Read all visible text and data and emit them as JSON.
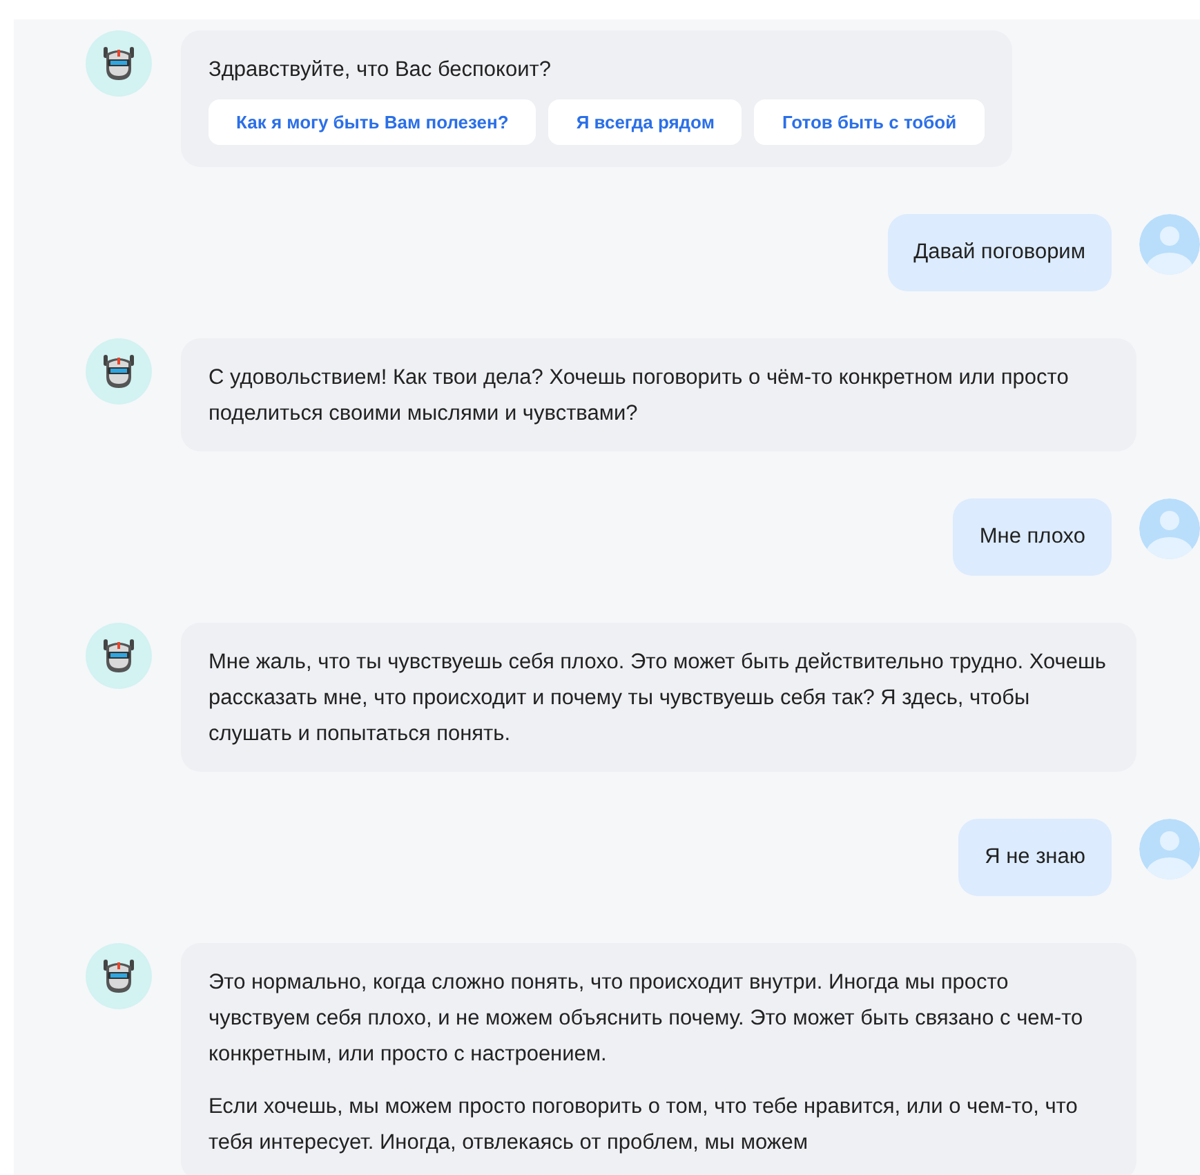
{
  "messages": [
    {
      "kind": "bot",
      "paragraphs": [
        "Здравствуйте, что Вас беспокоит?"
      ],
      "options": [
        "Как я могу быть Вам полезен?",
        "Я всегда рядом",
        "Готов быть с тобой"
      ]
    },
    {
      "kind": "user",
      "paragraphs": [
        "Давай поговорим"
      ]
    },
    {
      "kind": "bot",
      "paragraphs": [
        "С удовольствием! Как твои дела? Хочешь поговорить о чём-то конкретном или просто поделиться своими мыслями и чувствами?"
      ]
    },
    {
      "kind": "user",
      "paragraphs": [
        "Мне плохо"
      ]
    },
    {
      "kind": "bot",
      "paragraphs": [
        "Мне жаль, что ты чувствуешь себя плохо. Это может быть действительно трудно. Хочешь рассказать мне, что происходит и почему ты чувствуешь себя так? Я здесь, чтобы слушать и попытаться понять."
      ]
    },
    {
      "kind": "user",
      "paragraphs": [
        "Я не знаю"
      ]
    },
    {
      "kind": "bot",
      "paragraphs": [
        "Это нормально, когда сложно понять, что происходит внутри. Иногда мы просто чувствуем себя плохо, и не можем объяснить почему. Это может быть связано с чем-то конкретным, или просто с настроением.",
        "Если хочешь, мы можем просто поговорить о том, что тебе нравится, или о чем-то, что тебя интересует. Иногда, отвлекаясь от проблем, мы можем"
      ]
    }
  ]
}
